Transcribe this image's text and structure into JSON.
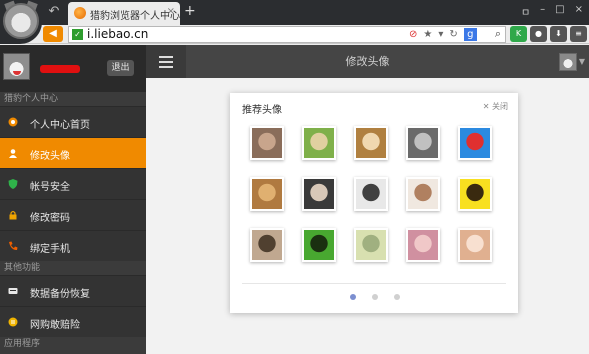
{
  "browser": {
    "tab_title": "猎豹浏览器个人中心",
    "tab_close": "×",
    "new_tab": "+",
    "url": "i.liebao.cn",
    "search_engine_badge": "g",
    "win_controls": [
      "ㅁ",
      "–",
      "□",
      "×"
    ]
  },
  "sidebar": {
    "logout_label": "退出",
    "section1": "猎豹个人中心",
    "items1": [
      {
        "label": "个人中心首页",
        "icon": "home-icon",
        "color": "#f08a00"
      },
      {
        "label": "修改头像",
        "icon": "avatar-icon",
        "color": "#ffffff",
        "active": true
      },
      {
        "label": "帐号安全",
        "icon": "shield-icon",
        "color": "#2fb34a"
      },
      {
        "label": "修改密码",
        "icon": "lock-icon",
        "color": "#f0a400"
      },
      {
        "label": "绑定手机",
        "icon": "phone-icon",
        "color": "#f06000"
      }
    ],
    "section2": "其他功能",
    "items2": [
      {
        "label": "数据备份恢复",
        "icon": "backup-icon",
        "color": "#e8e8e8"
      },
      {
        "label": "网购敢赔险",
        "icon": "insurance-icon",
        "color": "#f0b400"
      }
    ],
    "section3": "应用程序"
  },
  "content": {
    "title": "修改头像"
  },
  "panel": {
    "title": "推荐头像",
    "close_label": "关闭",
    "avatars": [
      [
        "#8a6d5a",
        "#c8a58c"
      ],
      [
        "#7fb04a",
        "#e0d0a0"
      ],
      [
        "#b08040",
        "#f0d8b0"
      ],
      [
        "#6a6a6a",
        "#c0c0c0"
      ],
      [
        "#2b8ae0",
        "#e03030"
      ],
      [
        "#b07a40",
        "#e0b070"
      ],
      [
        "#3a3a3a",
        "#d8c8b8"
      ],
      [
        "#e8e8e8",
        "#404040"
      ],
      [
        "#f0e8e0",
        "#b08060"
      ],
      [
        "#f8e020",
        "#3a2a10"
      ],
      [
        "#c0a890",
        "#504030"
      ],
      [
        "#48a830",
        "#1a3010"
      ],
      [
        "#d8e0b0",
        "#a0b080"
      ],
      [
        "#d090a0",
        "#f0c8c8"
      ],
      [
        "#e0b090",
        "#f8e0d0"
      ]
    ],
    "page_count": 3,
    "active_page": 1
  }
}
